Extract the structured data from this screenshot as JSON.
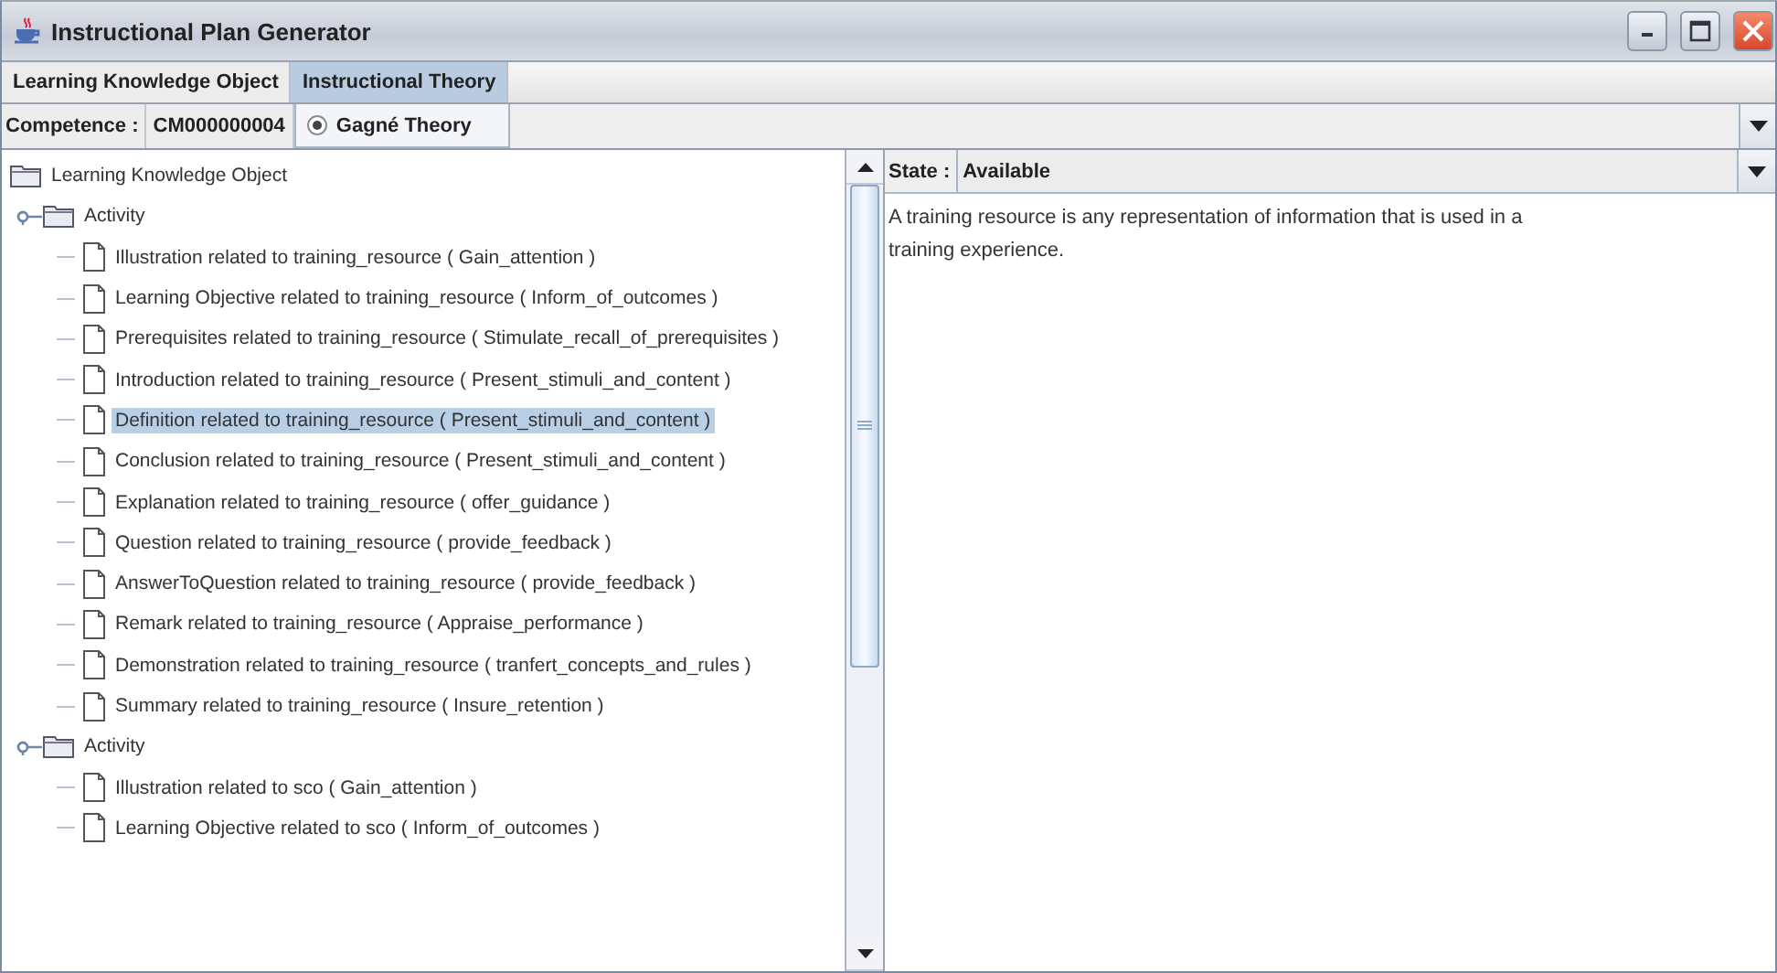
{
  "window": {
    "title": "Instructional Plan Generator"
  },
  "tabs": [
    {
      "label": "Learning Knowledge Object",
      "selected": false
    },
    {
      "label": "Instructional Theory",
      "selected": true
    }
  ],
  "competence": {
    "label": "Competence :",
    "value": "CM000000004"
  },
  "theories": [
    {
      "label": "Gagné Theory",
      "selected": true
    }
  ],
  "tree": {
    "label": "Learning Knowledge Object",
    "kind": "folder",
    "selected": false,
    "children": [
      {
        "label": "Activity",
        "kind": "folder",
        "expanded": true,
        "selected": false,
        "children": [
          {
            "label": "Illustration related to training_resource ( Gain_attention )",
            "kind": "file",
            "selected": false
          },
          {
            "label": "Learning Objective related to training_resource ( Inform_of_outcomes )",
            "kind": "file",
            "selected": false
          },
          {
            "label": "Prerequisites related to training_resource ( Stimulate_recall_of_prerequisites )",
            "kind": "file",
            "selected": false
          },
          {
            "label": "Introduction related to training_resource ( Present_stimuli_and_content )",
            "kind": "file",
            "selected": false
          },
          {
            "label": "Definition related to training_resource ( Present_stimuli_and_content )",
            "kind": "file",
            "selected": true
          },
          {
            "label": "Conclusion related to training_resource ( Present_stimuli_and_content )",
            "kind": "file",
            "selected": false
          },
          {
            "label": "Explanation related to training_resource ( offer_guidance )",
            "kind": "file",
            "selected": false
          },
          {
            "label": "Question related to training_resource ( provide_feedback )",
            "kind": "file",
            "selected": false
          },
          {
            "label": "AnswerToQuestion related to training_resource ( provide_feedback )",
            "kind": "file",
            "selected": false
          },
          {
            "label": "Remark related to training_resource ( Appraise_performance )",
            "kind": "file",
            "selected": false
          },
          {
            "label": "Demonstration related to training_resource ( tranfert_concepts_and_rules )",
            "kind": "file",
            "selected": false
          },
          {
            "label": "Summary related to training_resource ( Insure_retention )",
            "kind": "file",
            "selected": false
          }
        ]
      },
      {
        "label": "Activity",
        "kind": "folder",
        "expanded": true,
        "selected": false,
        "children": [
          {
            "label": "Illustration related to sco ( Gain_attention )",
            "kind": "file",
            "selected": false
          },
          {
            "label": "Learning Objective related to sco ( Inform_of_outcomes )",
            "kind": "file",
            "selected": false
          }
        ]
      }
    ]
  },
  "state": {
    "label": "State :",
    "value": "Available"
  },
  "description": "A training resource is any representation of information that is used in a training experience."
}
